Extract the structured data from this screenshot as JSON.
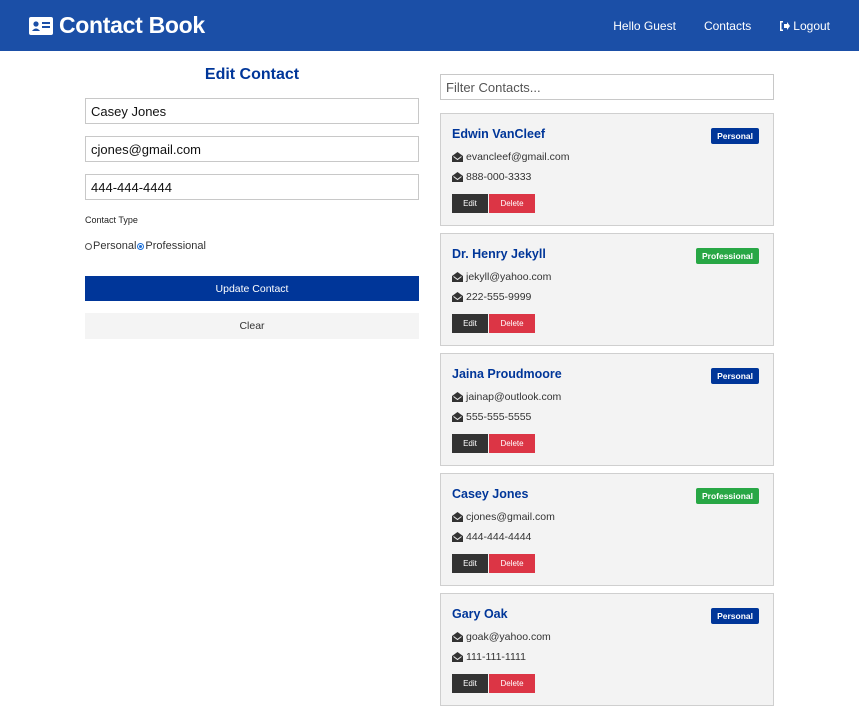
{
  "app": {
    "title": "Contact Book"
  },
  "nav": {
    "greeting": "Hello Guest",
    "contacts": "Contacts",
    "logout": "Logout"
  },
  "form": {
    "title": "Edit Contact",
    "name": "Casey Jones",
    "email": "cjones@gmail.com",
    "phone": "444-444-4444",
    "type_label": "Contact Type",
    "type_options": [
      "Personal",
      "Professional"
    ],
    "selected_type": "Professional",
    "update_label": "Update Contact",
    "clear_label": "Clear"
  },
  "filter": {
    "placeholder": "Filter Contacts..."
  },
  "colors": {
    "navbar": "#1b4fa7",
    "primary": "#003699",
    "personal": "#003699",
    "professional": "#28a745",
    "danger": "#dc3545",
    "dark": "#333333"
  },
  "contacts": [
    {
      "name": "Edwin VanCleef",
      "email": "evancleef@gmail.com",
      "phone": "888-000-3333",
      "type": "Personal",
      "edit": "Edit",
      "delete": "Delete"
    },
    {
      "name": "Dr. Henry Jekyll",
      "email": "jekyll@yahoo.com",
      "phone": "222-555-9999",
      "type": "Professional",
      "edit": "Edit",
      "delete": "Delete"
    },
    {
      "name": "Jaina Proudmoore",
      "email": "jainap@outlook.com",
      "phone": "555-555-5555",
      "type": "Personal",
      "edit": "Edit",
      "delete": "Delete"
    },
    {
      "name": "Casey Jones",
      "email": "cjones@gmail.com",
      "phone": "444-444-4444",
      "type": "Professional",
      "edit": "Edit",
      "delete": "Delete"
    },
    {
      "name": "Gary Oak",
      "email": "goak@yahoo.com",
      "phone": "111-111-1111",
      "type": "Personal",
      "edit": "Edit",
      "delete": "Delete"
    }
  ]
}
